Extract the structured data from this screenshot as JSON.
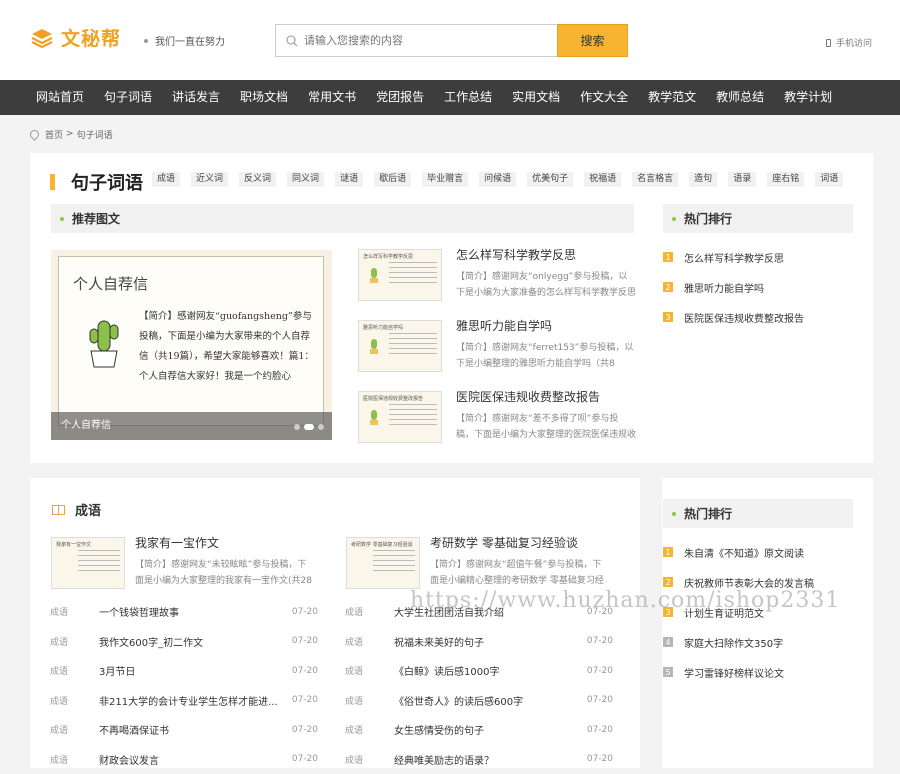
{
  "header": {
    "logo_text": "文秘帮",
    "slogan": "我们一直在努力",
    "search_placeholder": "请输入您搜索的内容",
    "search_button": "搜索",
    "mobile_link": "手机访问"
  },
  "nav": [
    "网站首页",
    "句子词语",
    "讲话发言",
    "职场文档",
    "常用文书",
    "党团报告",
    "工作总结",
    "实用文档",
    "作文大全",
    "教学范文",
    "教师总结",
    "教学计划"
  ],
  "breadcrumb": {
    "home": "首页",
    "sep": ">",
    "current": "句子词语"
  },
  "category": {
    "title": "句子词语",
    "tags": [
      "成语",
      "近义词",
      "反义词",
      "同义词",
      "谜语",
      "歇后语",
      "毕业赠言",
      "问候语",
      "优美句子",
      "祝福语",
      "名言格言",
      "造句",
      "语录",
      "座右铭",
      "词语"
    ]
  },
  "recommend": {
    "heading": "推荐图文",
    "slide": {
      "card_title": "个人自荐信",
      "card_text": "【简介】感谢网友“guofangsheng”参与投稿，下面是小编为大家带来的个人自荐信（共19篇），希望大家能够喜欢！篇1：个人自荐信大家好！我是一个约脸心",
      "caption": "个人自荐信"
    },
    "articles": [
      {
        "thumb_title": "怎么样写科学教学反思",
        "title": "怎么样写科学教学反思",
        "desc": "【简介】感谢网友“onlyegg”参与投稿，以下是小编为大家准备的怎么样写科学教学反思（..."
      },
      {
        "thumb_title": "雅思听力能自学吗",
        "title": "雅思听力能自学吗",
        "desc": "【简介】感谢网友“ferret153”参与投稿，以下是小编整理的雅思听力能自学吗（共8篇）..."
      },
      {
        "thumb_title": "医院医保违规收费整改报告",
        "title": "医院医保违规收费整改报告",
        "desc": "【简介】感谢网友“差不多得了呗”参与投稿，下面是小编为大家整理的医院医保违规收费整..."
      }
    ]
  },
  "hot1": {
    "heading": "热门排行",
    "items": [
      "怎么样写科学教学反思",
      "雅思听力能自学吗",
      "医院医保违规收费整改报告"
    ]
  },
  "chengyu": {
    "heading": "成语",
    "features": [
      {
        "thumb_title": "我家有一宝作文",
        "title": "我家有一宝作文",
        "desc": "【简介】感谢网友“未较眩眩”参与投稿，下面是小编为大家整理的我家有一宝作文(共28篇)..."
      },
      {
        "thumb_title": "考研数学 零基础复习经验谈",
        "title": "考研数学 零基础复习经验谈",
        "desc": "【简介】感谢网友“超值午餐”参与投稿，下面是小编精心整理的考研数学 零基础复习经验..."
      }
    ],
    "left_rows": [
      {
        "cat": "成语",
        "title": "一个钱袋哲理故事",
        "date": "07-20"
      },
      {
        "cat": "成语",
        "title": "我作文600字_初二作文",
        "date": "07-20"
      },
      {
        "cat": "成语",
        "title": "3月节日",
        "date": "07-20"
      },
      {
        "cat": "成语",
        "title": "非211大学的会计专业学生怎样才能进...",
        "date": "07-20"
      },
      {
        "cat": "成语",
        "title": "不再喝酒保证书",
        "date": "07-20"
      },
      {
        "cat": "成语",
        "title": "财政会议发言",
        "date": "07-20"
      }
    ],
    "right_rows": [
      {
        "cat": "成语",
        "title": "大学生社团团活自我介绍",
        "date": "07-20"
      },
      {
        "cat": "成语",
        "title": "祝福未来美好的句子",
        "date": "07-20"
      },
      {
        "cat": "成语",
        "title": "《白鲸》读后感1000字",
        "date": "07-20"
      },
      {
        "cat": "成语",
        "title": "《俗世奇人》的读后感600字",
        "date": "07-20"
      },
      {
        "cat": "成语",
        "title": "女生感情受伤的句子",
        "date": "07-20"
      },
      {
        "cat": "成语",
        "title": "经典唯美励志的语录？",
        "date": "07-20"
      }
    ]
  },
  "hot2": {
    "heading": "热门排行",
    "items": [
      "朱自清《不知道》原文阅读",
      "庆祝教师节表彰大会的发言稿",
      "计划生育证明范文",
      "家庭大扫除作文350字",
      "学习雷锋好榜样议论文"
    ]
  },
  "watermark": "https://www.huzhan.com/ishop2331",
  "colors": {
    "accent": "#f7b430",
    "nav_bg": "#3d3d3d",
    "green_dot": "#8ec63f"
  }
}
